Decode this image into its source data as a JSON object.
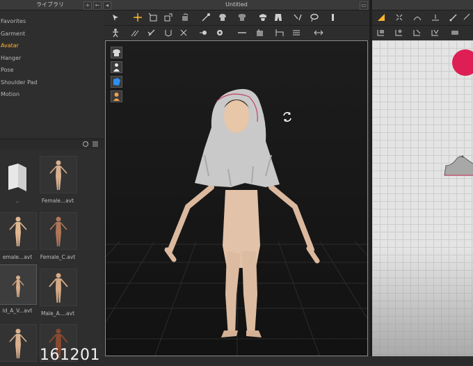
{
  "library": {
    "title": "ライブラリ",
    "add_btn": "+",
    "back_btn": "←",
    "tree": [
      "Favorites",
      "Garment",
      "Avatar",
      "Hanger",
      "Pose",
      "Shoulder Pad",
      "Motion"
    ],
    "selected": "Avatar",
    "items": [
      {
        "label": ".."
      },
      {
        "label": "Female...avt"
      },
      {
        "label": "emale...avt"
      },
      {
        "label": "Female_C.avt"
      },
      {
        "label": "ld_A_V...avt"
      },
      {
        "label": "Male_A....avt"
      },
      {
        "label": ""
      },
      {
        "label": ""
      }
    ],
    "overlay_number": "161201"
  },
  "viewport": {
    "title": "Untitled"
  },
  "colors": {
    "accent": "#ffb62c",
    "pattern_marker": "#dd1f55",
    "viewport_bg": "#1a1a1a"
  }
}
